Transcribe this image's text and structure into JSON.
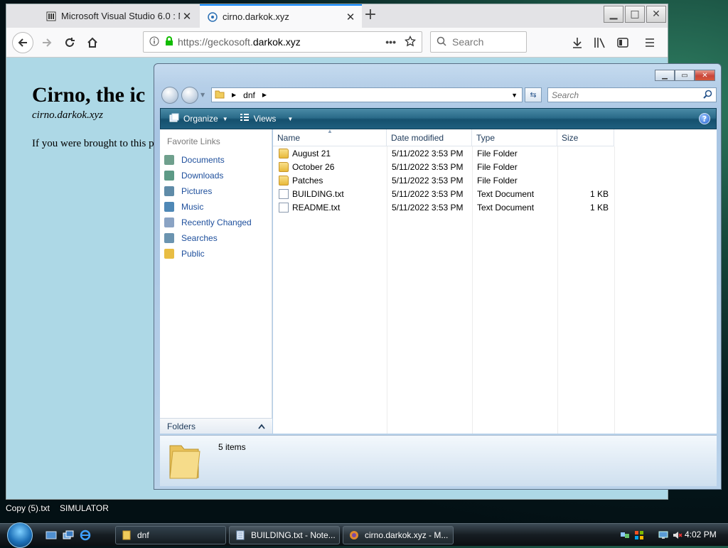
{
  "desktop": {
    "label_1": "Copy (5).txt",
    "label_2": "SIMULATOR"
  },
  "firefox": {
    "tabs": [
      {
        "title": "Microsoft Visual Studio 6.0 : M",
        "icon": "vs-icon"
      },
      {
        "title": "cirno.darkok.xyz",
        "icon": "site-icon"
      }
    ],
    "url_prefix": "https://geckosoft.",
    "url_domain": "darkok.xyz",
    "search_placeholder": "Search",
    "page": {
      "heading": "Cirno, the ic",
      "subtitle": "cirno.darkok.xyz",
      "paragraph": "If you were brought to this p"
    },
    "page_bg": "#add8e6"
  },
  "explorer": {
    "address": "dnf",
    "search_placeholder": "Search",
    "toolbar": {
      "organize": "Organize",
      "views": "Views",
      "help": "?"
    },
    "favorites_title": "Favorite Links",
    "favorites": [
      "Documents",
      "Downloads",
      "Pictures",
      "Music",
      "Recently Changed",
      "Searches",
      "Public"
    ],
    "folders_label": "Folders",
    "columns": [
      "Name",
      "Date modified",
      "Type",
      "Size"
    ],
    "rows": [
      {
        "name": "August 21",
        "date": "5/11/2022 3:53 PM",
        "type": "File Folder",
        "size": "",
        "icon": "folder-icon"
      },
      {
        "name": "October 26",
        "date": "5/11/2022 3:53 PM",
        "type": "File Folder",
        "size": "",
        "icon": "folder-icon"
      },
      {
        "name": "Patches",
        "date": "5/11/2022 3:53 PM",
        "type": "File Folder",
        "size": "",
        "icon": "folder-icon"
      },
      {
        "name": "BUILDING.txt",
        "date": "5/11/2022 3:53 PM",
        "type": "Text Document",
        "size": "1 KB",
        "icon": "text-file-icon"
      },
      {
        "name": "README.txt",
        "date": "5/11/2022 3:53 PM",
        "type": "Text Document",
        "size": "1 KB",
        "icon": "text-file-icon"
      }
    ],
    "status": "5 items"
  },
  "taskbar": {
    "buttons": [
      {
        "label": "dnf",
        "icon": "folder-icon"
      },
      {
        "label": "BUILDING.txt - Note...",
        "icon": "notepad-icon"
      },
      {
        "label": "cirno.darkok.xyz - M...",
        "icon": "firefox-icon"
      }
    ],
    "clock": "4:02 PM"
  }
}
